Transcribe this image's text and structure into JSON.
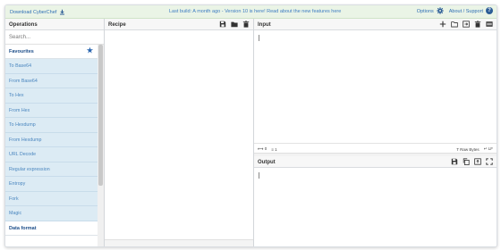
{
  "banner": {
    "download_label": "Download CyberChef",
    "notice": "Last build: A month ago - Version 10 is here! Read about the new features here",
    "options_label": "Options",
    "about_label": "About / Support"
  },
  "operations": {
    "title": "Operations",
    "search_placeholder": "Search...",
    "favourites_label": "Favourites",
    "items": [
      "To Base64",
      "From Base64",
      "To Hex",
      "From Hex",
      "To Hexdump",
      "From Hexdump",
      "URL Decode",
      "Regular expression",
      "Entropy",
      "Fork",
      "Magic"
    ],
    "next_category": "Data format"
  },
  "recipe": {
    "title": "Recipe"
  },
  "input": {
    "title": "Input",
    "length": "0",
    "lines": "1",
    "raw_bytes_label": "Raw Bytes",
    "line_ending": "LF"
  },
  "output": {
    "title": "Output"
  },
  "colors": {
    "accent": "#2c5d96",
    "banner_bg": "#eaf4e6",
    "op_bg": "#dcebf4"
  }
}
